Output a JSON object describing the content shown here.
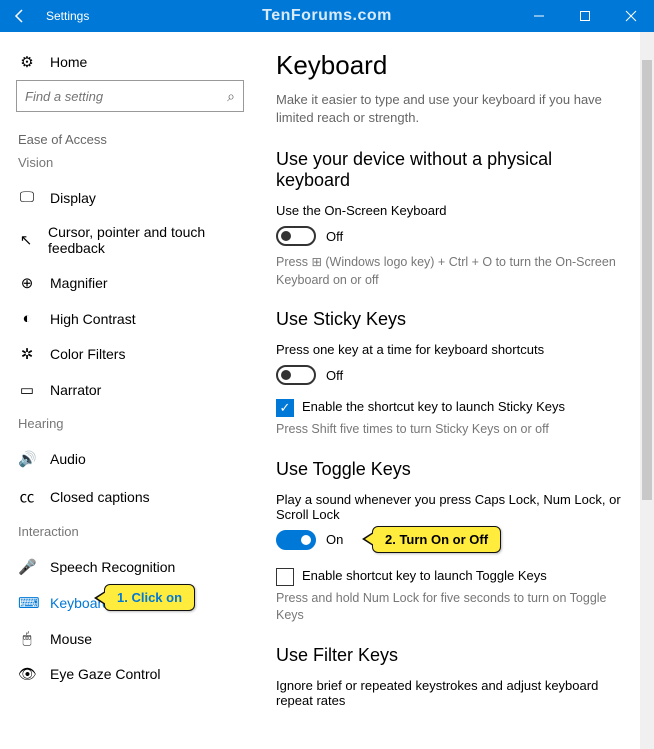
{
  "titlebar": {
    "title": "Settings",
    "watermark": "TenForums.com"
  },
  "sidebar": {
    "home": "Home",
    "search_placeholder": "Find a setting",
    "section": "Ease of Access",
    "groups": {
      "vision": "Vision",
      "hearing": "Hearing",
      "interaction": "Interaction"
    },
    "items": {
      "display": "Display",
      "cursor": "Cursor, pointer and touch feedback",
      "magnifier": "Magnifier",
      "high_contrast": "High Contrast",
      "color_filters": "Color Filters",
      "narrator": "Narrator",
      "audio": "Audio",
      "closed_captions": "Closed captions",
      "speech_recognition": "Speech Recognition",
      "keyboard": "Keyboard",
      "mouse": "Mouse",
      "eye_gaze": "Eye Gaze Control"
    }
  },
  "content": {
    "title": "Keyboard",
    "desc": "Make it easier to type and use your keyboard if you have limited reach or strength.",
    "osk": {
      "heading": "Use your device without a physical keyboard",
      "label": "Use the On-Screen Keyboard",
      "state": "Off",
      "hint_pre": "Press  ",
      "hint_post": " (Windows logo key) + Ctrl + O to turn the On-Screen Keyboard on or off"
    },
    "sticky": {
      "heading": "Use Sticky Keys",
      "label": "Press one key at a time for keyboard shortcuts",
      "state": "Off",
      "check": "Enable the shortcut key to launch Sticky Keys",
      "hint": "Press Shift five times to turn Sticky Keys on or off"
    },
    "toggle_keys": {
      "heading": "Use Toggle Keys",
      "label": "Play a sound whenever you press Caps Lock, Num Lock, or Scroll Lock",
      "state": "On",
      "check": "Enable shortcut key to launch Toggle Keys",
      "hint": "Press and hold Num Lock for five seconds to turn on Toggle Keys"
    },
    "filter": {
      "heading": "Use Filter Keys",
      "label": "Ignore brief or repeated keystrokes and adjust keyboard repeat rates"
    }
  },
  "callouts": {
    "one": "1. Click on",
    "two": "2. Turn On or Off"
  }
}
